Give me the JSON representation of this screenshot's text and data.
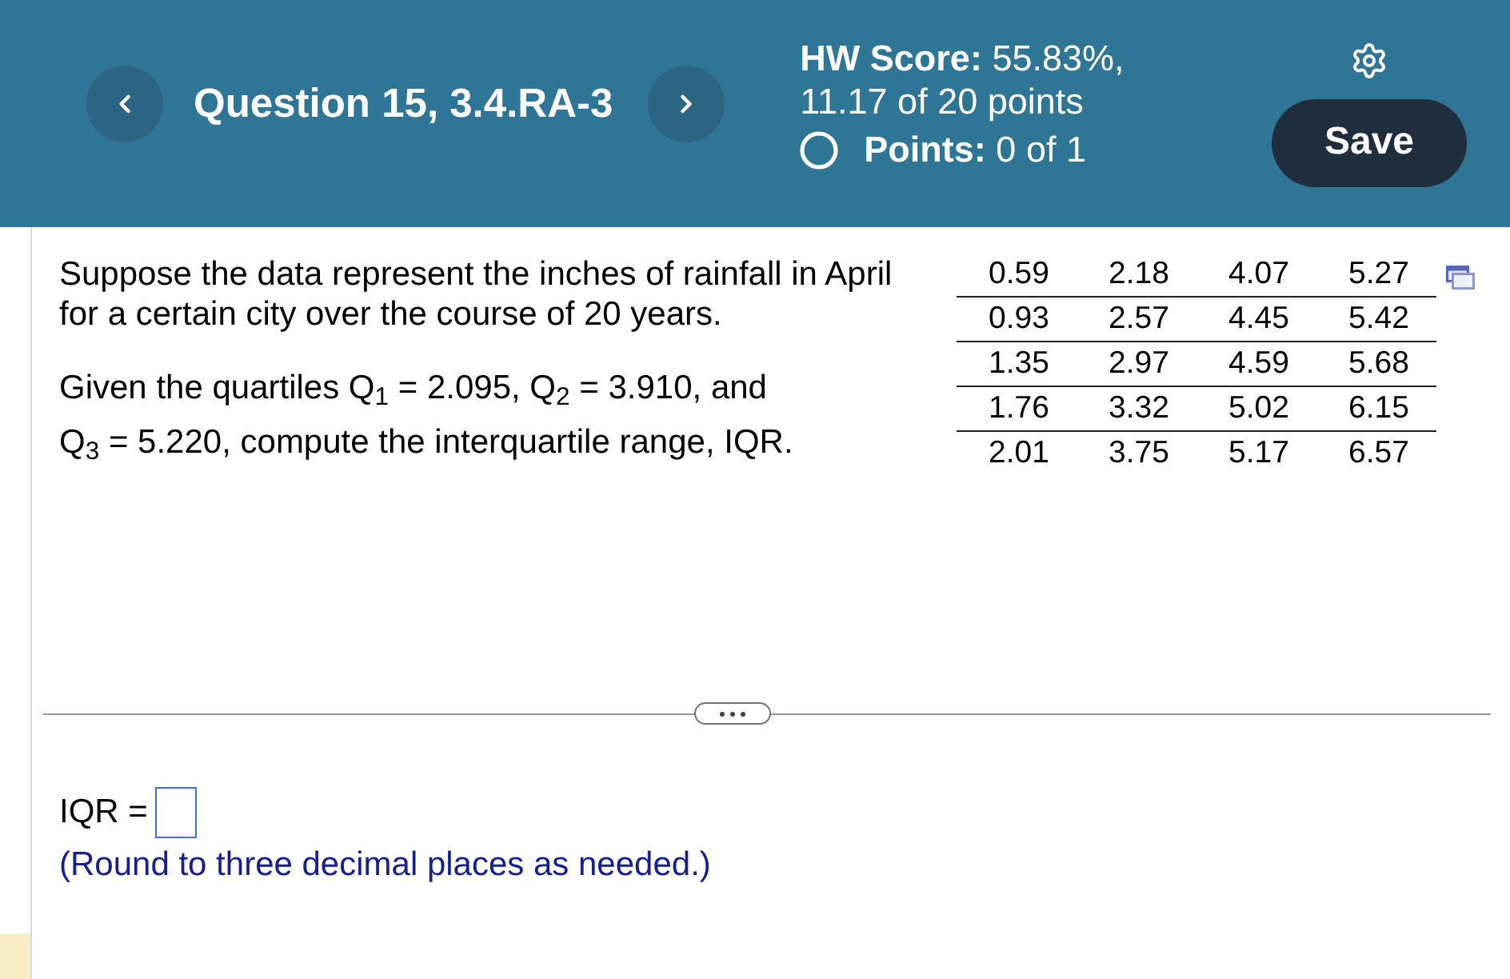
{
  "header": {
    "title": "Question 15, 3.4.RA-3",
    "score_lines": [
      "**HW Score:** 55.83%,",
      "11.17 of 20 points"
    ],
    "points": {
      "text": "**Points:** 0 of 1",
      "completed": false
    },
    "save_button": "Save"
  },
  "question": {
    "paragraphs": [
      "Suppose the data represent the inches of rainfall in April for a certain city over the course of 20 years.",
      "Given the quartiles Q$_{1}$ = 2.095, Q$_{2}$ = 3.910, and Q$_{3}$ = 5.220, compute the interquartile range, IQR."
    ]
  },
  "data_table": {
    "rows": [
      [
        "0.59",
        "2.18",
        "4.07",
        "5.27"
      ],
      [
        "0.93",
        "2.57",
        "4.45",
        "5.42"
      ],
      [
        "1.35",
        "2.97",
        "4.59",
        "5.68"
      ],
      [
        "1.76",
        "3.32",
        "5.02",
        "6.15"
      ],
      [
        "2.01",
        "3.75",
        "5.17",
        "6.57"
      ]
    ]
  },
  "answer": {
    "label": "IQR =",
    "hint": "(Round to three decimal places as needed.)"
  }
}
